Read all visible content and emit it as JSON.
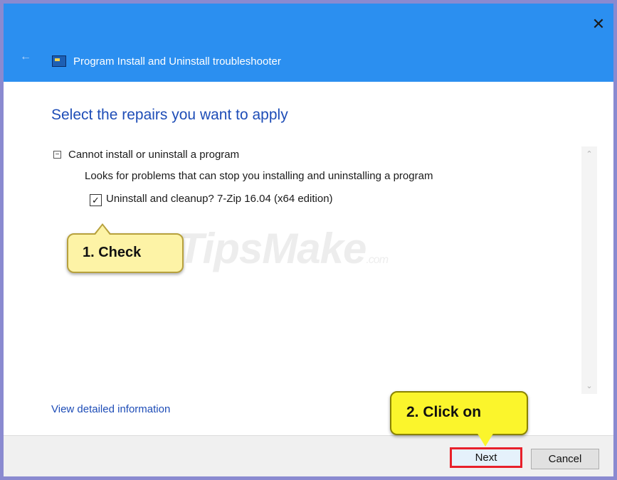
{
  "window": {
    "title": "Program Install and Uninstall troubleshooter",
    "close_glyph": "✕",
    "back_glyph": "←",
    "titlebar_color": "#2b8ff0"
  },
  "main": {
    "heading": "Select the repairs you want to apply",
    "group": {
      "collapse_glyph": "−",
      "title": "Cannot install or uninstall a program",
      "description": "Looks for problems that can stop you installing and uninstalling a program",
      "item": {
        "checked": true,
        "check_glyph": "✓",
        "label": "Uninstall and cleanup? 7-Zip 16.04 (x64 edition)"
      }
    },
    "scroll_up_glyph": "⌃",
    "scroll_down_glyph": "⌄",
    "link": "View detailed information"
  },
  "watermark": {
    "text": "TipsMake",
    "suffix": ".com"
  },
  "annotations": {
    "check": "1. Check",
    "click": "2. Click on",
    "highlight_color": "#e8202a"
  },
  "footer": {
    "next_label": "Next",
    "cancel_label": "Cancel"
  }
}
